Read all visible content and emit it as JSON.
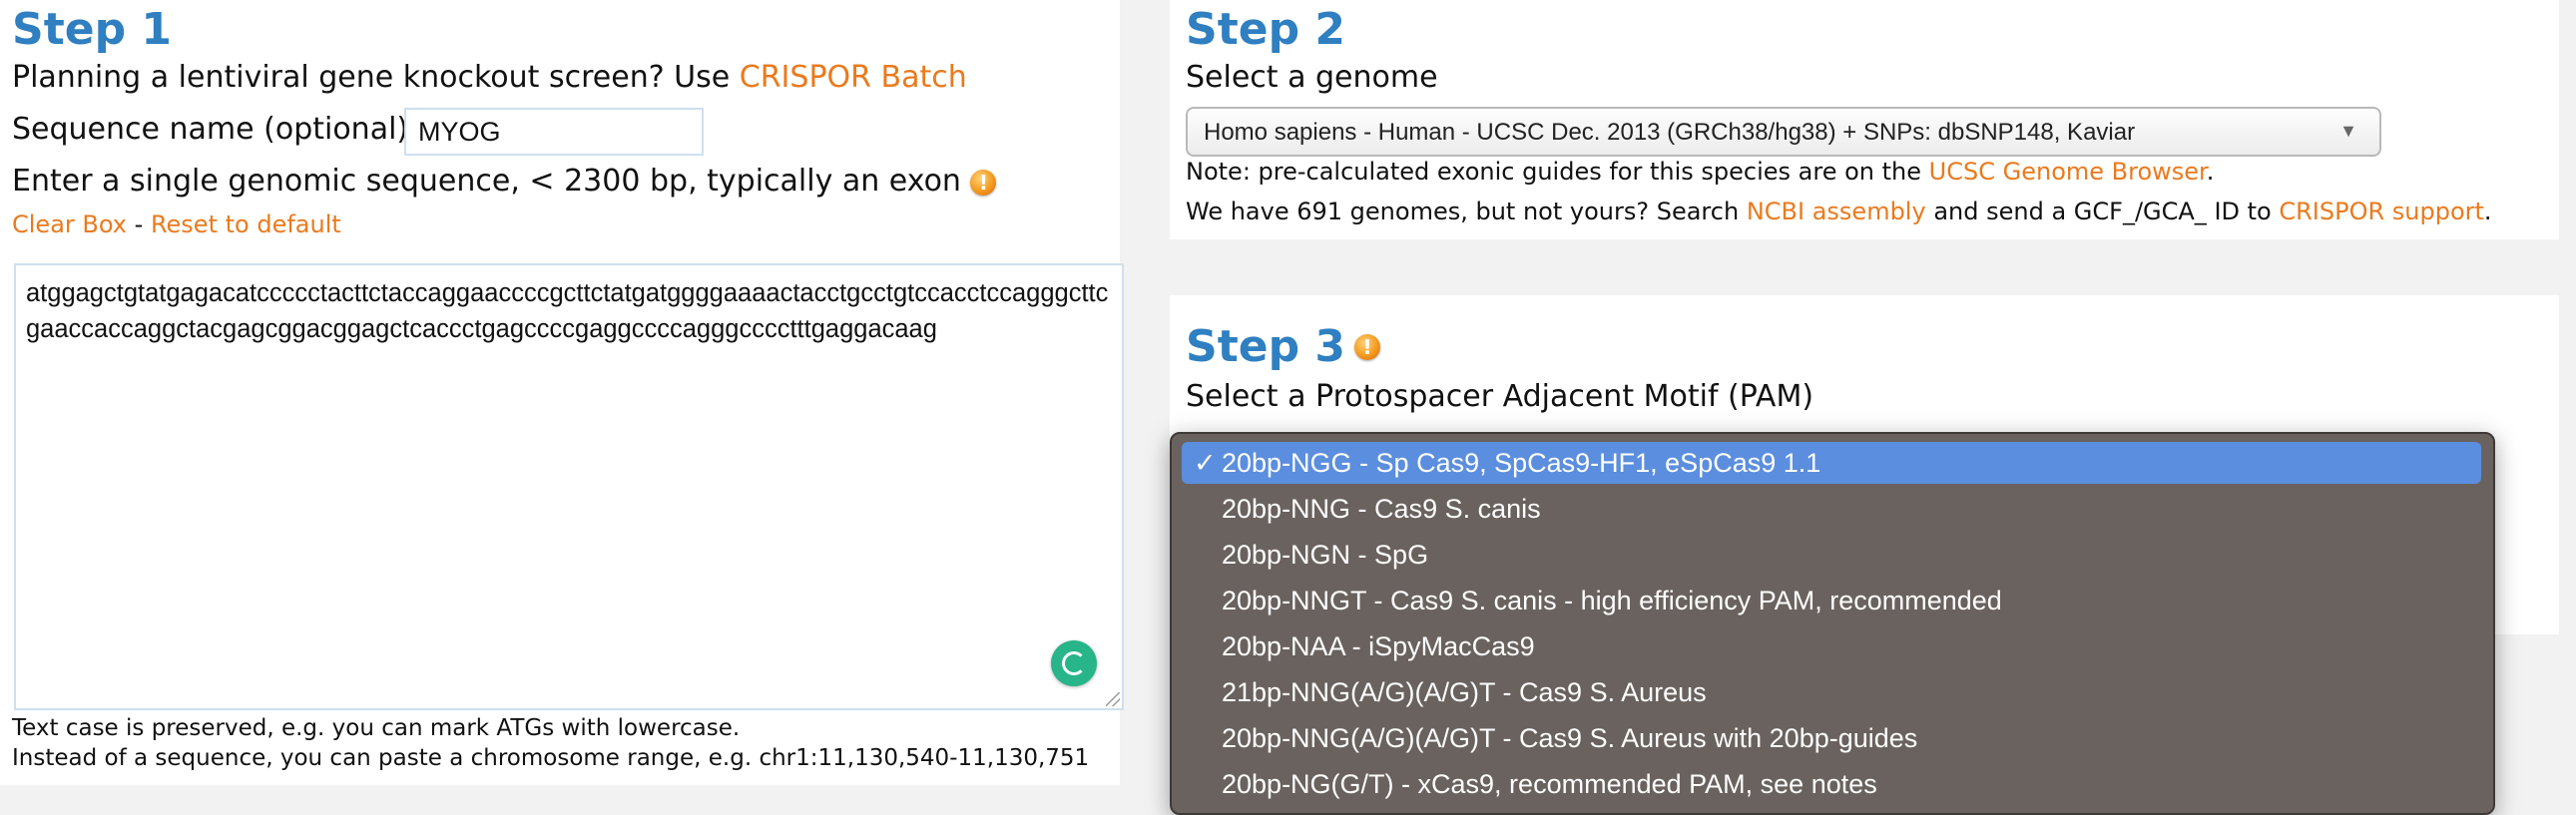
{
  "step1": {
    "title": "Step 1",
    "intro_text": "Planning a lentiviral gene knockout screen? Use",
    "batch_link": "CRISPOR Batch",
    "seqname_label": "Sequence name (optional):",
    "seqname_value": "MYOG",
    "seq_prompt": "Enter a single genomic sequence, < 2300 bp, typically an exon",
    "warn_glyph": "!",
    "clear_box": "Clear Box",
    "separator": " - ",
    "reset_default": "Reset to default",
    "sequence_value": "atggagctgtatgagacatccccctacttctaccaggaaccccgcttctatgatggggaaaactacctgcctgtccacctccagggcttcgaaccaccaggctacgagcggacggagctcaccctgagccccgaggccccagggcccctttgaggacaag",
    "note_case": "Text case is preserved, e.g. you can mark ATGs with lowercase.",
    "note_range": "Instead of a sequence, you can paste a chromosome range, e.g. chr1:11,130,540-11,130,751"
  },
  "step2": {
    "title": "Step 2",
    "subtitle": "Select a genome",
    "genome_selected": "Homo sapiens - Human - UCSC Dec. 2013 (GRCh38/hg38) + SNPs: dbSNP148, Kaviar",
    "dropdown_arrow": "▼",
    "note_prefix": "Note: pre-calculated exonic guides for this species are on the",
    "ucsc_link": "UCSC Genome Browser",
    "note_suffix": ".",
    "genomes_prefix": "We have 691 genomes, but not yours? Search",
    "ncbi_link": "NCBI assembly",
    "genomes_mid": "and send a GCF_/GCA_ ID to",
    "support_link": "CRISPOR support",
    "genomes_suffix": "."
  },
  "step3": {
    "title": "Step 3",
    "subtitle": "Select a Protospacer Adjacent Motif (PAM)",
    "warn_glyph": "!",
    "pam_options": [
      {
        "label": "20bp-NGG - Sp Cas9, SpCas9-HF1, eSpCas9 1.1",
        "check": "✓"
      },
      {
        "label": "20bp-NNG - Cas9 S. canis",
        "check": ""
      },
      {
        "label": "20bp-NGN - SpG",
        "check": ""
      },
      {
        "label": "20bp-NNGT - Cas9 S. canis - high efficiency PAM, recommended",
        "check": ""
      },
      {
        "label": "20bp-NAA - iSpyMacCas9",
        "check": ""
      },
      {
        "label": "21bp-NNG(A/G)(A/G)T - Cas9 S. Aureus",
        "check": ""
      },
      {
        "label": "20bp-NNG(A/G)(A/G)T - Cas9 S. Aureus with 20bp-guides",
        "check": ""
      },
      {
        "label": "20bp-NG(G/T) - xCas9, recommended PAM, see notes",
        "check": ""
      }
    ],
    "selected_index": 0
  },
  "colors": {
    "step_title": "#2f7fc1",
    "link": "#ea7a1d",
    "dropdown_bg": "#645c58",
    "dropdown_selected": "#5b8ede",
    "grammarly": "#27b589"
  }
}
